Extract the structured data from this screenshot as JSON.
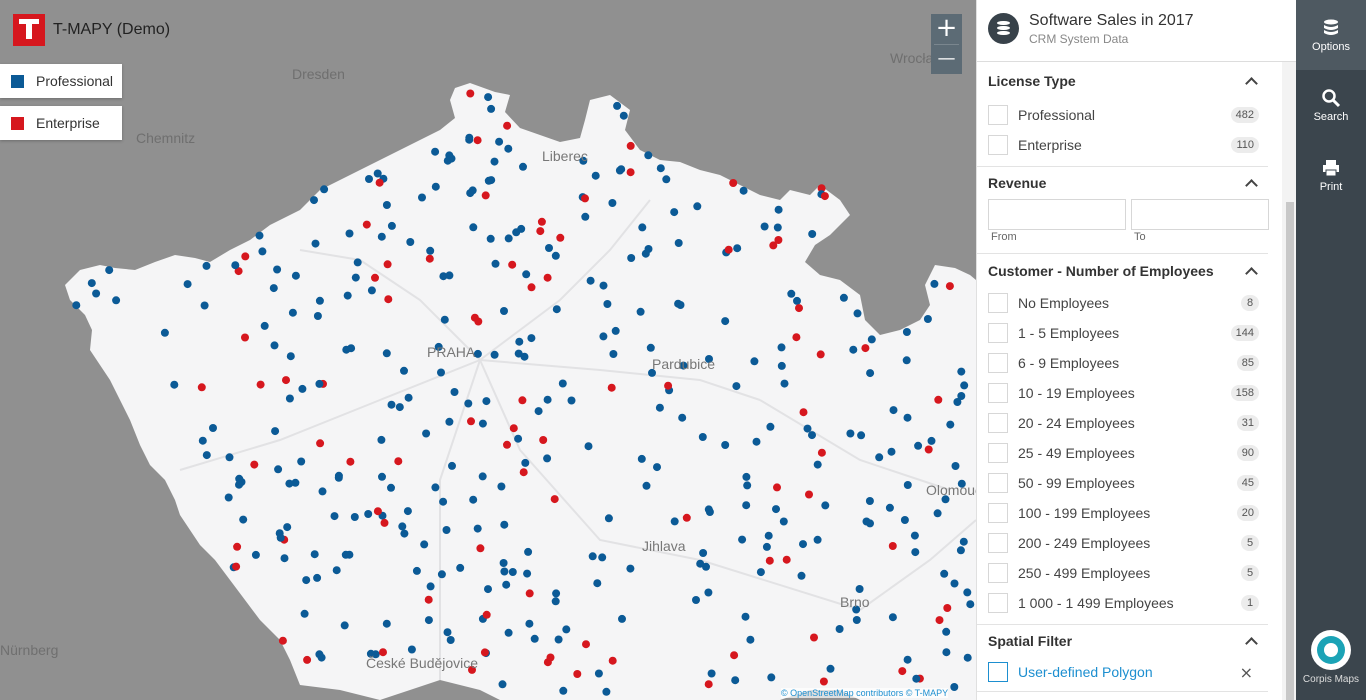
{
  "app": {
    "title": "T-MAPY (Demo)",
    "logo_text": "T-MAPY"
  },
  "legend": [
    {
      "label": "Professional",
      "color": "#0b5a96"
    },
    {
      "label": "Enterprise",
      "color": "#d6171e"
    }
  ],
  "map": {
    "zoom_in": "+",
    "zoom_out": "—",
    "attribution": "© OpenStreetMap contributors © T-MAPY",
    "cities": [
      "Dresden",
      "Chemnitz",
      "Liberec",
      "PRAHA",
      "Pardubice",
      "Jihlava",
      "České Budějovice",
      "Olomouc",
      "Brno",
      "Wrocław",
      "Nürnberg"
    ]
  },
  "panel": {
    "title": "Software Sales in 2017",
    "subtitle": "CRM System Data",
    "icon": "database-icon",
    "license": {
      "heading": "License Type",
      "items": [
        {
          "label": "Professional",
          "count": "482"
        },
        {
          "label": "Enterprise",
          "count": "110"
        }
      ]
    },
    "revenue": {
      "heading": "Revenue",
      "from_label": "From",
      "to_label": "To",
      "from_value": "",
      "to_value": ""
    },
    "employees": {
      "heading": "Customer - Number of Employees",
      "items": [
        {
          "label": "No Employees",
          "count": "8"
        },
        {
          "label": "1 - 5 Employees",
          "count": "144"
        },
        {
          "label": "6 - 9 Employees",
          "count": "85"
        },
        {
          "label": "10 - 19 Employees",
          "count": "158"
        },
        {
          "label": "20 - 24 Employees",
          "count": "31"
        },
        {
          "label": "25 - 49 Employees",
          "count": "90"
        },
        {
          "label": "50 - 99 Employees",
          "count": "45"
        },
        {
          "label": "100 - 199 Employees",
          "count": "20"
        },
        {
          "label": "200 - 249 Employees",
          "count": "5"
        },
        {
          "label": "250 - 499 Employees",
          "count": "5"
        },
        {
          "label": "1 000 - 1 499 Employees",
          "count": "1"
        }
      ]
    },
    "spatial": {
      "heading": "Spatial Filter",
      "polygon_label": "User-defined Polygon",
      "clear": "×"
    }
  },
  "toolbar": {
    "options": "Options",
    "search": "Search",
    "print": "Print",
    "brand": "Corpis Maps"
  }
}
